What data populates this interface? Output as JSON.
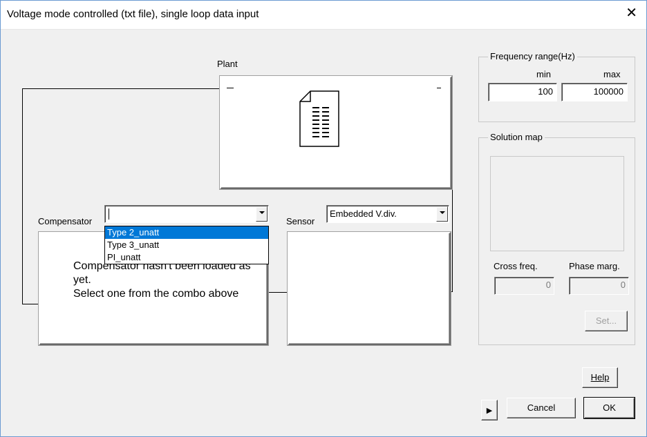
{
  "window": {
    "title": "Voltage mode controlled (txt file), single loop data input",
    "close_glyph": "✕"
  },
  "plant": {
    "label": "Plant",
    "icon": "document-icon"
  },
  "compensator": {
    "label": "Compensator",
    "combo_value": "",
    "options": [
      "Type 2_unatt",
      "Type 3_unatt",
      "PI_unatt"
    ],
    "selected_option": "Type 2_unatt",
    "message": "Compensator hasn't been loaded as yet.\nSelect one from the combo above"
  },
  "sensor": {
    "label": "Sensor",
    "combo_value": "Embedded V.div."
  },
  "frequency_range": {
    "title": "Frequency range(Hz)",
    "min_label": "min",
    "max_label": "max",
    "min_value": "100",
    "max_value": "100000"
  },
  "solution_map": {
    "title": "Solution map",
    "cross_freq_label": "Cross freq.",
    "phase_marg_label": "Phase marg.",
    "cross_freq_value": "0",
    "phase_marg_value": "0",
    "set_button": "Set..."
  },
  "buttons": {
    "help": "Help",
    "cancel": "Cancel",
    "ok": "OK",
    "play_glyph": "▶"
  }
}
